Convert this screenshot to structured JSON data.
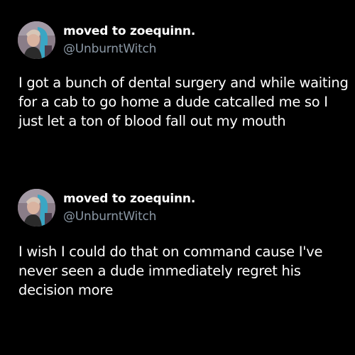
{
  "posts": [
    {
      "author": {
        "display_name": "moved to zoequinn.",
        "handle": "@UnburntWitch",
        "avatar_icon": "profile-photo"
      },
      "text": "I got a bunch of dental surgery and while waiting for a cab to go home a dude catcalled me so I just let a ton of blood fall out my mouth"
    },
    {
      "author": {
        "display_name": "moved to zoequinn.",
        "handle": "@UnburntWitch",
        "avatar_icon": "profile-photo"
      },
      "text": "I wish I could do that on command cause I've never seen a dude immediately regret his decision more"
    }
  ],
  "colors": {
    "background": "#000000",
    "name": "#ffffff",
    "handle": "#8b98a5",
    "text": "#ffffff"
  }
}
